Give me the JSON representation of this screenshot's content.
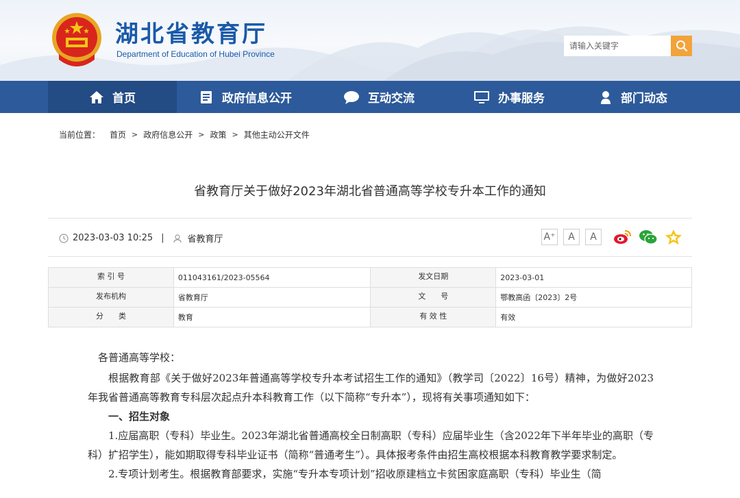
{
  "header": {
    "title": "湖北省教育厅",
    "subtitle": "Department of Education of Hubei Province",
    "search_placeholder": "请输入关键字"
  },
  "nav": {
    "items": [
      {
        "label": "首页",
        "icon": "home-icon"
      },
      {
        "label": "政府信息公开",
        "icon": "document-icon"
      },
      {
        "label": "互动交流",
        "icon": "chat-icon"
      },
      {
        "label": "办事服务",
        "icon": "monitor-icon"
      },
      {
        "label": "部门动态",
        "icon": "person-icon"
      }
    ]
  },
  "breadcrumb": {
    "label": "当前位置：",
    "items": [
      "首页",
      "政府信息公开",
      "政策",
      "其他主动公开文件"
    ]
  },
  "article": {
    "title": "省教育厅关于做好2023年湖北省普通高等学校专升本工作的通知",
    "datetime": "2023-03-03 10:25",
    "divider": "|",
    "source": "省教育厅",
    "font_buttons": [
      "A⁺",
      "A",
      "A"
    ]
  },
  "info": {
    "rows": [
      {
        "k1": "索 引 号",
        "v1": "011043161/2023-05564",
        "k2": "发文日期",
        "v2": "2023-03-01"
      },
      {
        "k1": "发布机构",
        "v1": "省教育厅",
        "k2": "文　　号",
        "v2": "鄂教高函〔2023〕2号"
      },
      {
        "k1": "分　　类",
        "v1": "教育",
        "k2": "有 效 性",
        "v2": "有效"
      }
    ]
  },
  "content": {
    "salutation": "各普通高等学校：",
    "p1": "根据教育部《关于做好2023年普通高等学校专升本考试招生工作的通知》（教学司〔2022〕16号）精神，为做好2023年我省普通高等教育专科层次起点升本科教育工作（以下简称“专升本”），现将有关事项通知如下：",
    "h1": "一、招生对象",
    "p2": "1.应届高职（专科）毕业生。2023年湖北省普通高校全日制高职（专科）应届毕业生（含2022年下半年毕业的高职（专科）扩招学生），能如期取得专科毕业证书（简称“普通考生”）。具体报考条件由招生高校根据本科教育教学要求制定。",
    "p3": "2.专项计划考生。根据教育部要求，实施“专升本专项计划”招收原建档立卡贫困家庭高职（专科）毕业生（简"
  },
  "colors": {
    "nav_bg": "#2d5a9a",
    "nav_active": "#234b84",
    "title_blue": "#1a5aa8",
    "search_button": "#f2a33a"
  }
}
